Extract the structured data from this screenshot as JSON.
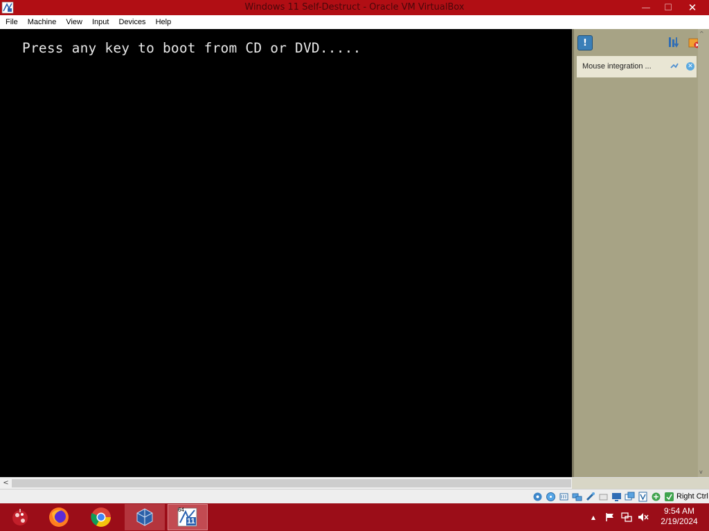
{
  "window": {
    "title": "Windows 11 Self-Destruct - Oracle VM VirtualBox",
    "close_glyph": "✕",
    "min_glyph": "—",
    "max_glyph": "☐"
  },
  "menu": {
    "items": [
      {
        "label": "File"
      },
      {
        "label": "Machine"
      },
      {
        "label": "View"
      },
      {
        "label": "Input"
      },
      {
        "label": "Devices"
      },
      {
        "label": "Help"
      }
    ]
  },
  "vm": {
    "console_text": "Press any key to boot from CD or DVD....."
  },
  "notification_pane": {
    "info_icon": "!",
    "notice_text": "Mouse integration ...",
    "notice_close_glyph": "✕"
  },
  "scrollbar": {
    "left_arrow": "<",
    "up_arrow": "^",
    "down_arrow": "v"
  },
  "statusbar": {
    "host_key_label": "Right Ctrl",
    "icons": [
      "hard-disk-icon",
      "optical-drive-icon",
      "audio-icon",
      "network-icon",
      "usb-icon",
      "shared-folders-icon",
      "display-icon",
      "recording-icon",
      "vt-x-icon",
      "mouse-integration-icon",
      "keyboard-capture-icon"
    ]
  },
  "taskbar": {
    "apps": [
      {
        "name": "start-orb-icon"
      },
      {
        "name": "firefox-icon"
      },
      {
        "name": "chrome-icon"
      },
      {
        "name": "virtualbox-icon"
      },
      {
        "name": "vm-window-icon",
        "badge_top": "64",
        "badge_num": "11"
      }
    ],
    "tray_arrow": "▲",
    "clock_time": "9:54 AM",
    "clock_date": "2/19/2024"
  },
  "colors": {
    "titlebar": "#b10e14",
    "taskbar": "#9b0d18",
    "pane": "#a7a385",
    "notice": "#e9e6d4"
  }
}
